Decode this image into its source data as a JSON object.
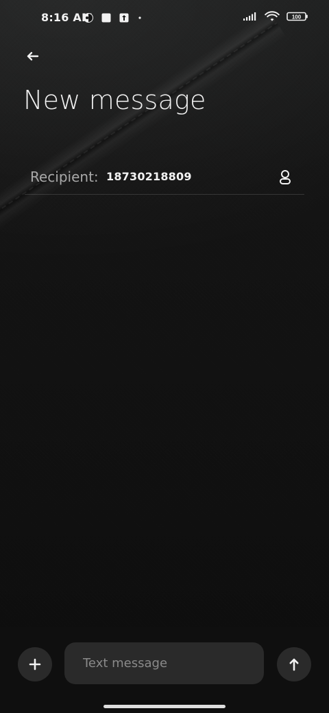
{
  "status_bar": {
    "time": "8:16 AM",
    "battery_text": "100",
    "left_icons": [
      "weather-status-icon",
      "notification-square-icon",
      "upload-status-icon",
      "dot-status-icon"
    ],
    "right_icons": [
      "cellular-signal-icon",
      "wifi-icon",
      "battery-icon"
    ]
  },
  "header": {
    "back_icon": "back-arrow-icon",
    "title": "New message"
  },
  "recipient": {
    "label": "Recipient:",
    "value": "18730218809",
    "contact_icon": "contact-picker-icon"
  },
  "composer": {
    "attach_icon": "plus-icon",
    "placeholder": "Text message",
    "value": "",
    "send_icon": "send-arrow-up-icon"
  },
  "colors": {
    "text_primary": "#f2f2f2",
    "text_secondary": "#a9a9a9",
    "surface": "#2a2a2a",
    "divider": "#2c2c2c"
  }
}
